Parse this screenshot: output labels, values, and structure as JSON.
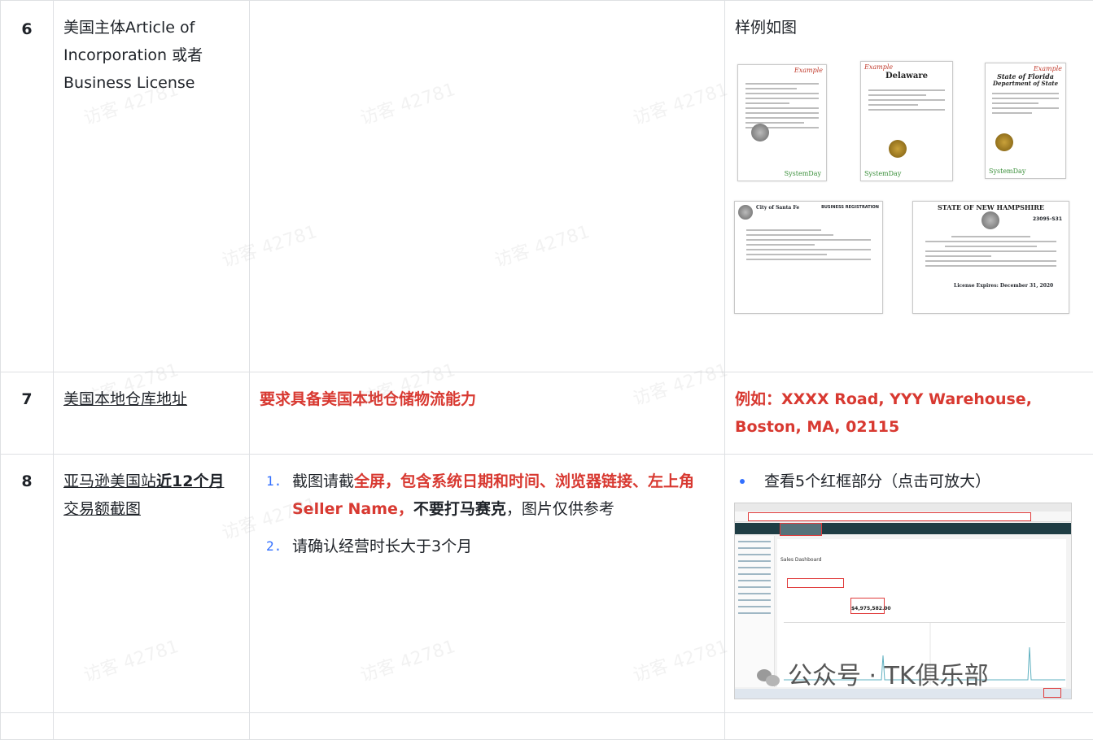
{
  "rows": [
    {
      "num": "6",
      "item": "美国主体Article of Incorporation 或者 Business License",
      "requirement": "",
      "example_caption": "样例如图",
      "samples": [
        {
          "label": "Example"
        },
        {
          "title": "Delaware",
          "label": "Example"
        },
        {
          "title": "State of Florida",
          "subtitle": "Department of State",
          "label": "Example"
        },
        {
          "title": "City of Santa Fe",
          "corner": "BUSINESS REGISTRATION"
        },
        {
          "title": "STATE OF NEW HAMPSHIRE",
          "number": "23095-S31",
          "expires": "License Expires: December 31, 2020"
        }
      ],
      "stamp": "SystemDay"
    },
    {
      "num": "7",
      "item": "美国本地仓库地址",
      "requirement": "要求具备美国本地仓储物流能力",
      "example": "例如：XXXX Road, YYY Warehouse, Boston, MA, 02115"
    },
    {
      "num": "8",
      "item_parts": [
        "亚马逊美国站",
        "近12个月",
        "交易额截图"
      ],
      "steps": [
        {
          "n": "1.",
          "parts": [
            "截图请截",
            "全屏，包含系统日期和时间、浏览器链接、左上角Seller Name，",
            "不要打马赛克",
            "，图片仅供参考"
          ]
        },
        {
          "n": "2.",
          "parts": [
            "请确认经营时长大于3个月"
          ]
        }
      ],
      "example": "查看5个红框部分（点击可放大）",
      "screenshot": {
        "heading": "Sales Dashboard",
        "sales_value": "$4,975,582.00"
      }
    }
  ],
  "watermark": "访客 42781",
  "brand": "公众号 · TK俱乐部",
  "colors": {
    "accent_red": "#d83931",
    "list_blue": "#3370ff",
    "border": "#dee0e3"
  }
}
